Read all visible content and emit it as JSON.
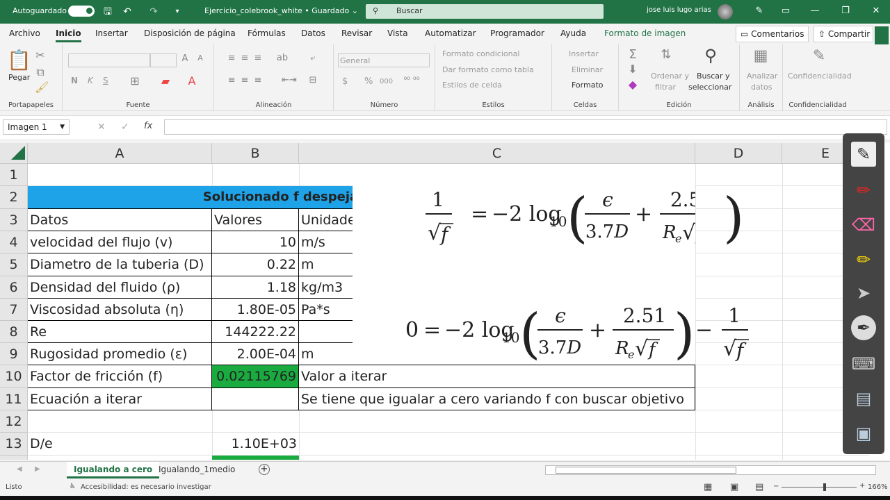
{
  "titlebar": {
    "autosave": "Autoguardado",
    "filename": "Ejercicio_colebrook_white • Guardado ⌄",
    "search_placeholder": "Buscar",
    "user": "jose luis lugo arias"
  },
  "menu": {
    "items": [
      "Archivo",
      "Inicio",
      "Insertar",
      "Disposición de página",
      "Fórmulas",
      "Datos",
      "Revisar",
      "Vista",
      "Automatizar",
      "Programador",
      "Ayuda",
      "Formato de imagen"
    ],
    "comments": "Comentarios",
    "share": "Compartir"
  },
  "ribbon": {
    "clipboard": {
      "paste": "Pegar",
      "label": "Portapapeles"
    },
    "font": {
      "bold": "N",
      "italic": "K",
      "underline": "S",
      "label": "Fuente"
    },
    "alignment": {
      "label": "Alineación"
    },
    "number": {
      "format": "General",
      "currency": "$",
      "percent": "%",
      "comma": "000",
      "label": "Número"
    },
    "styles": {
      "conditional": "Formato condicional",
      "table": "Dar formato como tabla",
      "cell": "Estilos de celda",
      "label": "Estilos"
    },
    "cells": {
      "insert": "Insertar",
      "delete": "Eliminar",
      "format": "Formato",
      "label": "Celdas"
    },
    "editing": {
      "sort1": "Ordenar y",
      "sort2": "filtrar",
      "find1": "Buscar y",
      "find2": "seleccionar",
      "label": "Edición"
    },
    "analysis": {
      "a1": "Analizar",
      "a2": "datos",
      "label": "Análisis"
    },
    "confidential": {
      "c1": "Confidencialidad",
      "label": "Confidencialidad"
    }
  },
  "formula_bar": {
    "namebox": "Imagen 1",
    "fx": "fx",
    "value": ""
  },
  "columns": [
    "A",
    "B",
    "C",
    "D",
    "E"
  ],
  "rows": [
    "1",
    "2",
    "3",
    "4",
    "5",
    "6",
    "7",
    "8",
    "9",
    "10",
    "11",
    "12",
    "13"
  ],
  "cells": {
    "title": "Solucionado f despejando e igualando a cero",
    "r3": [
      "Datos",
      "Valores",
      "Unidades"
    ],
    "r4": [
      "velocidad del flujo (v)",
      "10",
      "m/s"
    ],
    "r5": [
      "Diametro de la tuberia (D)",
      "0.22",
      "m"
    ],
    "r6": [
      "Densidad del fluido (ρ)",
      "1.18",
      "kg/m3"
    ],
    "r7": [
      "Viscosidad absoluta (η)",
      "1.80E-05",
      "Pa*s"
    ],
    "r8": [
      "Re",
      "144222.22",
      ""
    ],
    "r9": [
      "Rugosidad promedio (ε)",
      "2.00E-04",
      "m"
    ],
    "r10": [
      "Factor de fricción (f)",
      "0.02115769",
      "Valor a iterar"
    ],
    "r11": [
      "Ecuación a iterar",
      "",
      "Se tiene que igualar a cero variando f con buscar objetivo"
    ],
    "r13": [
      "D/e",
      "1.10E+03",
      ""
    ]
  },
  "sheet_tabs": [
    "Igualando a cero",
    "Igualando_1medio"
  ],
  "status": {
    "ready": "Listo",
    "accessibility": "Accesibilidad: es necesario investigar",
    "zoom": "166%"
  },
  "colors": {
    "excel_green": "#217346",
    "header_blue": "#1fa3e8",
    "cell_green": "#1aab40"
  }
}
